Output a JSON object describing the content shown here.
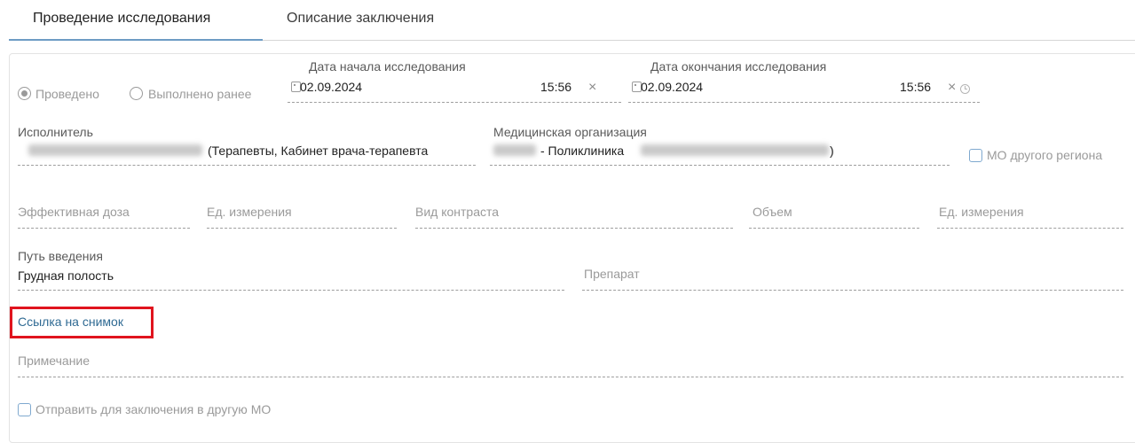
{
  "tabs": {
    "active": "Проведение исследования",
    "second": "Описание заключения"
  },
  "status": {
    "option_done": "Проведено",
    "option_earlier": "Выполнено ранее",
    "selected": "Проведено"
  },
  "start": {
    "label": "Дата начала исследования",
    "date": "02.09.2024",
    "time": "15:56"
  },
  "end": {
    "label": "Дата окончания исследования",
    "date": "02.09.2024",
    "time": "15:56"
  },
  "executor": {
    "label": "Исполнитель",
    "value": "(Терапевты, Кабинет врача-терапевта"
  },
  "organization": {
    "label": "Медицинская организация",
    "value": "- Поликлиника",
    "suffix": ")"
  },
  "other_region": {
    "label": "МО другого региона",
    "checked": false
  },
  "dose_row": {
    "effective_dose": "Эффективная доза",
    "unit1": "Ед. измерения",
    "contrast_type": "Вид контраста",
    "volume": "Объем",
    "unit2": "Ед. измерения"
  },
  "route": {
    "label": "Путь введения",
    "value": "Грудная полость"
  },
  "drug": {
    "placeholder": "Препарат"
  },
  "image_link": "Ссылка на снимок",
  "note": {
    "placeholder": "Примечание"
  },
  "send_other": {
    "label": "Отправить для заключения в другую МО",
    "checked": false
  },
  "colors": {
    "accent": "#6d9cc4",
    "link": "#2f6a93",
    "highlight": "#e0141e"
  }
}
